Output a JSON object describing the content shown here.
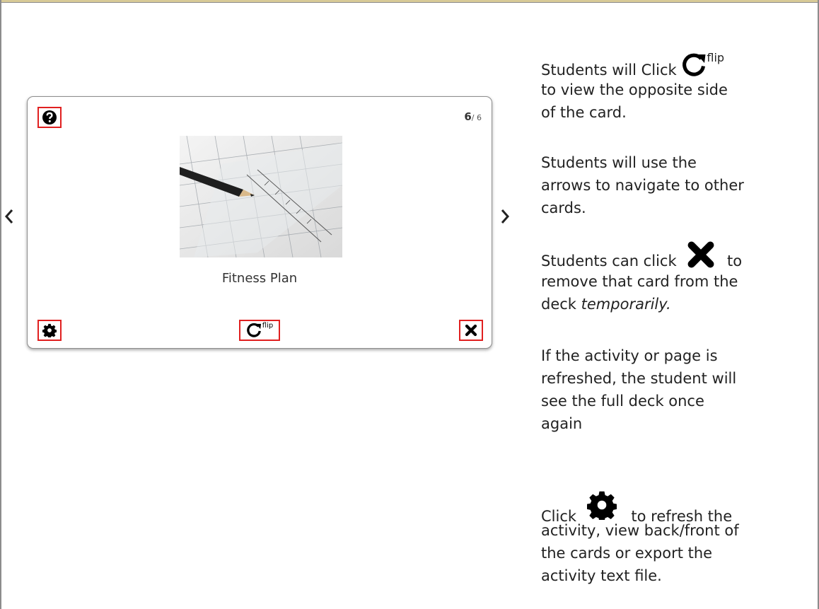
{
  "card": {
    "counter_current": "6",
    "counter_total": "/ 6",
    "title": "Fitness Plan",
    "flip_label": "flip",
    "image_icon": "pencil-and-ruler-photo"
  },
  "nav": {
    "prev_icon": "chevron-left-icon",
    "next_icon": "chevron-right-icon"
  },
  "instructions": {
    "p1_before": "Students will Click",
    "p1_flip_label": "flip",
    "p1_line2": "to view the opposite side",
    "p1_line3": "of the card.",
    "p2_line1": "Students will use the",
    "p2_line2": "arrows to navigate to other",
    "p2_line3": "cards.",
    "p3_before": "Students can click",
    "p3_after": "to",
    "p3_line2": "remove that card from the",
    "p3_line3_a": "deck",
    "p3_line3_b": "temporarily.",
    "p4_line1": "If the activity or page is",
    "p4_line2": "refreshed, the student will",
    "p4_line3": "see the full deck once",
    "p4_line4": "again",
    "p5_before": "Click",
    "p5_after": "to refresh the",
    "p5_line2": "activity, view back/front of",
    "p5_line3": "the cards or export the",
    "p5_line4": "activity text file."
  },
  "colors": {
    "highlight": "#e02020",
    "top_bar": "#d8ca97"
  }
}
